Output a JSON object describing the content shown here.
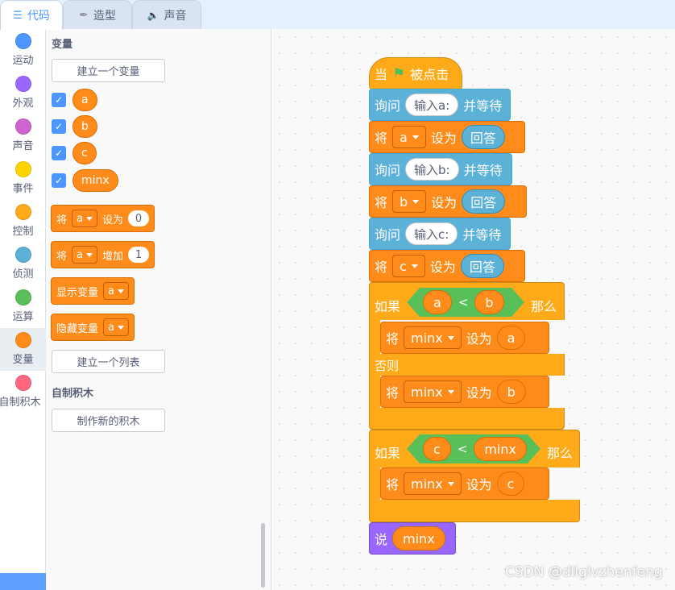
{
  "tabs": [
    {
      "label": "代码",
      "icon": "code-icon"
    },
    {
      "label": "造型",
      "icon": "brush-icon"
    },
    {
      "label": "声音",
      "icon": "speaker-icon"
    }
  ],
  "categories": [
    {
      "label": "运动",
      "color": "#4c97ff"
    },
    {
      "label": "外观",
      "color": "#9966ff"
    },
    {
      "label": "声音",
      "color": "#cf63cf"
    },
    {
      "label": "事件",
      "color": "#ffd500"
    },
    {
      "label": "控制",
      "color": "#ffab19"
    },
    {
      "label": "侦测",
      "color": "#5cb1d6"
    },
    {
      "label": "运算",
      "color": "#59c059"
    },
    {
      "label": "变量",
      "color": "#ff8c1a"
    },
    {
      "label": "自制积木",
      "color": "#ff6680"
    }
  ],
  "palette": {
    "section_variables": "变量",
    "make_variable": "建立一个变量",
    "variables": [
      "a",
      "b",
      "c",
      "minx"
    ],
    "set_block": {
      "label": "将",
      "var": "a",
      "verb": "设为",
      "value": "0"
    },
    "change_block": {
      "label": "将",
      "var": "a",
      "verb": "增加",
      "value": "1"
    },
    "show_block": {
      "label": "显示变量",
      "var": "a"
    },
    "hide_block": {
      "label": "隐藏变量",
      "var": "a"
    },
    "make_list": "建立一个列表",
    "section_myblocks": "自制积木",
    "make_block": "制作新的积木"
  },
  "script": {
    "hat": {
      "pre": "当",
      "post": "被点击"
    },
    "ask1": {
      "label": "询问",
      "text": "输入a:",
      "post": "并等待"
    },
    "set1": {
      "label": "将",
      "var": "a",
      "verb": "设为",
      "value": "回答"
    },
    "ask2": {
      "label": "询问",
      "text": "输入b:",
      "post": "并等待"
    },
    "set2": {
      "label": "将",
      "var": "b",
      "verb": "设为",
      "value": "回答"
    },
    "ask3": {
      "label": "询问",
      "text": "输入c:",
      "post": "并等待"
    },
    "set3": {
      "label": "将",
      "var": "c",
      "verb": "设为",
      "value": "回答"
    },
    "if1": {
      "label": "如果",
      "left": "a",
      "op": "<",
      "right": "b",
      "then": "那么",
      "else": "否则"
    },
    "if1_then": {
      "label": "将",
      "var": "minx",
      "verb": "设为",
      "value": "a"
    },
    "if1_else": {
      "label": "将",
      "var": "minx",
      "verb": "设为",
      "value": "b"
    },
    "if2": {
      "label": "如果",
      "left": "c",
      "op": "<",
      "right": "minx",
      "then": "那么"
    },
    "if2_then": {
      "label": "将",
      "var": "minx",
      "verb": "设为",
      "value": "c"
    },
    "say": {
      "label": "说",
      "value": "minx"
    }
  },
  "watermark": "CSDN @dllglvzhenfeng"
}
